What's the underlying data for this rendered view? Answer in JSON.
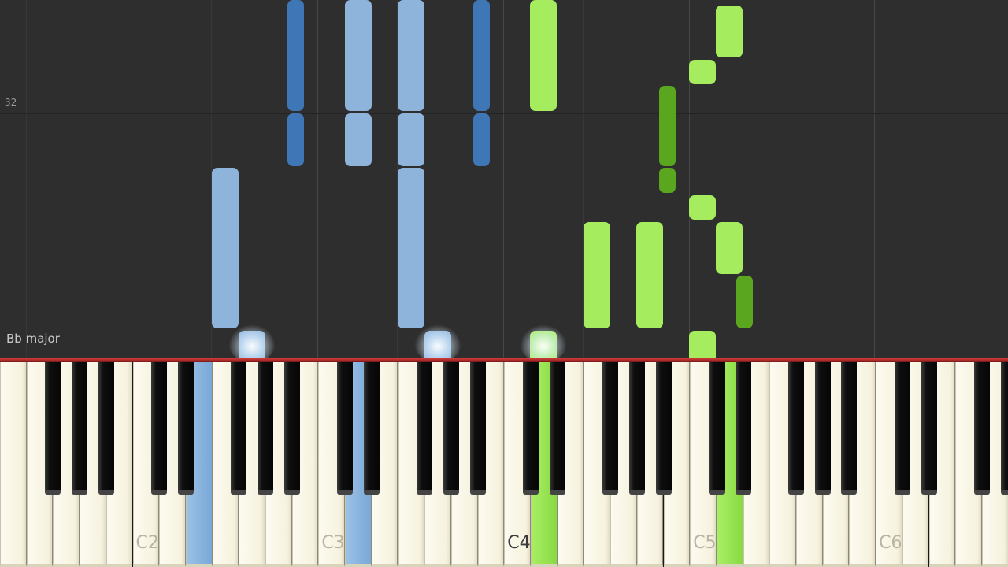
{
  "piano_roll": {
    "measure_number": "32",
    "key_signature": "Bb major",
    "colors": {
      "left_hand_white": "#8fb4dc",
      "left_hand_black": "#3f76b6",
      "right_hand_white": "#a5ed5f",
      "right_hand_black": "#5aa61e",
      "background": "#2e2e2e"
    }
  },
  "keyboard": {
    "octave_labels": [
      "C2",
      "C3",
      "C4",
      "C5",
      "C6"
    ],
    "pressed_keys": [
      {
        "note": "E2",
        "hand": "left"
      },
      {
        "note": "D3",
        "hand": "left"
      },
      {
        "note": "D4",
        "hand": "right"
      },
      {
        "note": "D5",
        "hand": "right"
      }
    ]
  }
}
